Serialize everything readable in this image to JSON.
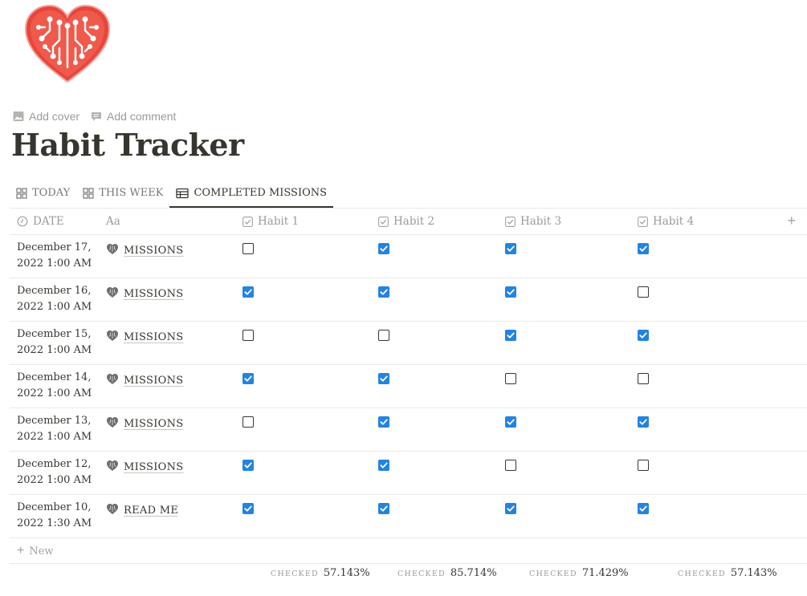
{
  "page": {
    "actions": {
      "add_cover": "Add cover",
      "add_comment": "Add comment"
    },
    "title": "Habit Tracker"
  },
  "tabs": [
    {
      "label": "TODAY",
      "icon": "gallery-icon"
    },
    {
      "label": "THIS WEEK",
      "icon": "gallery-icon"
    },
    {
      "label": "COMPLETED MISSIONS",
      "icon": "table-icon",
      "active": true
    }
  ],
  "columns": {
    "date": "DATE",
    "name": "Aa",
    "habit1": "Habit 1",
    "habit2": "Habit 2",
    "habit3": "Habit 3",
    "habit4": "Habit 4"
  },
  "rows": [
    {
      "date_line1": "December 17,",
      "date_line2": "2022 1:00 AM",
      "name": "MISSIONS",
      "habits": [
        false,
        true,
        true,
        true
      ]
    },
    {
      "date_line1": "December 16,",
      "date_line2": "2022 1:00 AM",
      "name": "MISSIONS",
      "habits": [
        true,
        true,
        true,
        false
      ]
    },
    {
      "date_line1": "December 15,",
      "date_line2": "2022 1:00 AM",
      "name": "MISSIONS",
      "habits": [
        false,
        false,
        true,
        true
      ]
    },
    {
      "date_line1": "December 14,",
      "date_line2": "2022 1:00 AM",
      "name": "MISSIONS",
      "habits": [
        true,
        true,
        false,
        false
      ]
    },
    {
      "date_line1": "December 13,",
      "date_line2": "2022 1:00 AM",
      "name": "MISSIONS",
      "habits": [
        false,
        true,
        true,
        true
      ]
    },
    {
      "date_line1": "December 12,",
      "date_line2": "2022 1:00 AM",
      "name": "MISSIONS",
      "habits": [
        true,
        true,
        false,
        false
      ]
    },
    {
      "date_line1": "December 10,",
      "date_line2": "2022 1:30 AM",
      "name": "READ ME",
      "habits": [
        true,
        true,
        true,
        true
      ]
    }
  ],
  "new_row_label": "New",
  "footer": {
    "label": "CHECKED",
    "habit1": "57.143%",
    "habit2": "85.714%",
    "habit3": "71.429%",
    "habit4": "57.143%"
  },
  "colors": {
    "checkbox_checked": "#2383e2",
    "heart_icon": "#e8453c",
    "text": "#37352f"
  }
}
